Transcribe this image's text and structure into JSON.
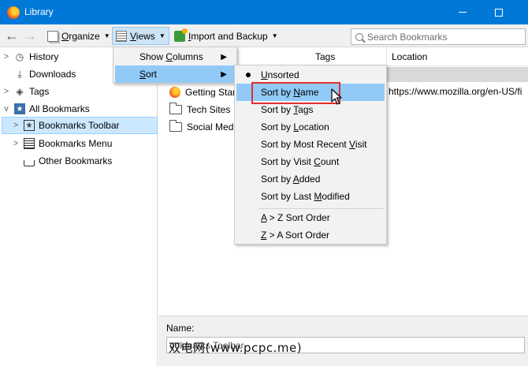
{
  "window": {
    "title": "Library",
    "app_icon": "firefox-icon"
  },
  "toolbar": {
    "organize": {
      "prefix": "",
      "underlined": "O",
      "suffix": "rganize"
    },
    "views": {
      "prefix": "",
      "underlined": "V",
      "suffix": "iews"
    },
    "import": {
      "prefix": "",
      "underlined": "I",
      "suffix": "mport and Backup"
    },
    "search_placeholder": "Search Bookmarks"
  },
  "sidebar": {
    "items": [
      {
        "label": "History",
        "icon": "clock-icon",
        "expand": ">"
      },
      {
        "label": "Downloads",
        "icon": "download-icon",
        "expand": ""
      },
      {
        "label": "Tags",
        "icon": "tag-icon",
        "expand": ">"
      },
      {
        "label": "All Bookmarks",
        "icon": "star-icon",
        "expand": "v"
      },
      {
        "label": "Bookmarks Toolbar",
        "icon": "bookmarks-toolbar-icon",
        "expand": ">"
      },
      {
        "label": "Bookmarks Menu",
        "icon": "bookmarks-menu-icon",
        "expand": ">"
      },
      {
        "label": "Other Bookmarks",
        "icon": "tray-icon",
        "expand": ""
      }
    ]
  },
  "columns": {
    "tags": "Tags",
    "location": "Location"
  },
  "rows": [
    {
      "name": "Getting Star",
      "icon": "firefox-icon",
      "location": "https://www.mozilla.org/en-US/fi"
    },
    {
      "name": "Tech Sites",
      "icon": "folder-icon",
      "location": ""
    },
    {
      "name": "Social Medi",
      "icon": "folder-icon",
      "location": ""
    }
  ],
  "views_menu": {
    "items": [
      {
        "prefix": "Show ",
        "underlined": "C",
        "suffix": "olumns"
      },
      {
        "prefix": "",
        "underlined": "S",
        "suffix": "ort"
      }
    ]
  },
  "sort_menu": {
    "items": [
      {
        "prefix": "",
        "underlined": "U",
        "suffix": "nsorted"
      },
      {
        "prefix": "Sort by ",
        "underlined": "N",
        "suffix": "ame"
      },
      {
        "prefix": "Sort by ",
        "underlined": "T",
        "suffix": "ags"
      },
      {
        "prefix": "Sort by ",
        "underlined": "L",
        "suffix": "ocation"
      },
      {
        "prefix": "Sort by Most Recent ",
        "underlined": "V",
        "suffix": "isit"
      },
      {
        "prefix": "Sort by Visit ",
        "underlined": "C",
        "suffix": "ount"
      },
      {
        "prefix": "Sort by ",
        "underlined": "A",
        "suffix": "dded"
      },
      {
        "prefix": "Sort by Last ",
        "underlined": "M",
        "suffix": "odified"
      },
      {
        "prefix": "",
        "underlined": "A",
        "suffix": " > Z Sort Order"
      },
      {
        "prefix": "",
        "underlined": "Z",
        "suffix": " > A Sort Order"
      }
    ]
  },
  "details": {
    "name_label": "Name:",
    "name_value": "ookmarks Toolbar"
  },
  "watermark": "双电网(www.pcpc.me)",
  "colors": {
    "titlebar": "#0078d7",
    "selection": "#cce8ff",
    "menu_hover": "#91c9f7",
    "callout": "#e0312e"
  }
}
